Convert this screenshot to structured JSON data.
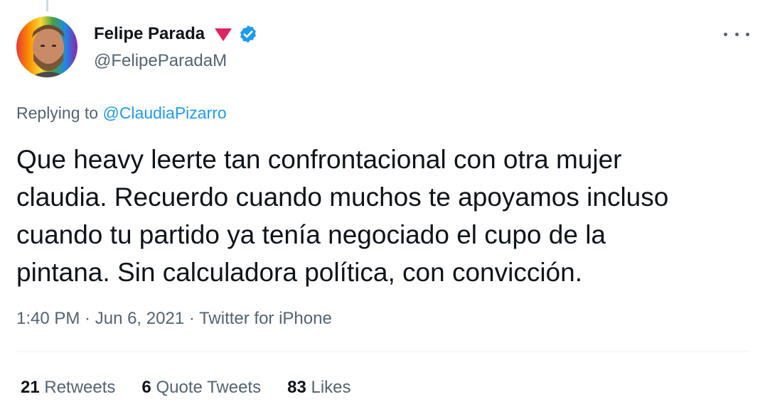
{
  "author": {
    "display_name": "Felipe Parada",
    "handle": "@FelipeParadaM",
    "badge_icon": "red-down-triangle-icon",
    "verified_icon": "verified-badge-icon"
  },
  "reply": {
    "prefix": "Replying to ",
    "mention": "@ClaudiaPizarro"
  },
  "tweet": {
    "text": "Que heavy leerte tan confrontacional con otra mujer\nclaudia. Recuerdo cuando muchos te apoyamos incluso\ncuando tu partido ya tenía negociado el cupo de la\npintana. Sin calculadora política, con convicción."
  },
  "meta": {
    "time": "1:40 PM",
    "separator": " · ",
    "date": "Jun 6, 2021",
    "source": "Twitter for iPhone"
  },
  "stats": {
    "retweets": {
      "count": "21",
      "label": " Retweets"
    },
    "quotes": {
      "count": "6",
      "label": " Quote Tweets"
    },
    "likes": {
      "count": "83",
      "label": " Likes"
    }
  },
  "colors": {
    "accent": "#1d9bf0",
    "secondary_text": "#536471",
    "primary_text": "#0f1419",
    "triangle": "#e0245e"
  }
}
